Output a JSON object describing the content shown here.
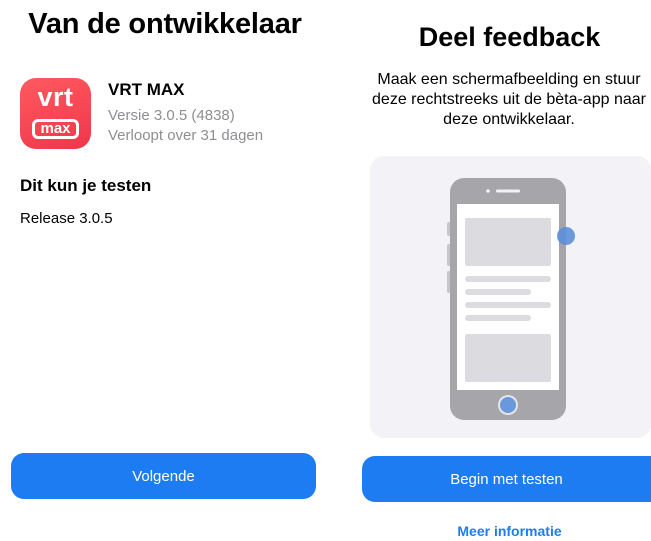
{
  "left": {
    "title": "Van de ontwikkelaar",
    "app": {
      "icon_top": "vrt",
      "icon_bottom": "max",
      "name": "VRT MAX",
      "version": "Versie 3.0.5 (4838)",
      "expiry": "Verloopt over 31 dagen"
    },
    "section_heading": "Dit kun je testen",
    "release_note": "Release 3.0.5",
    "next_button": "Volgende"
  },
  "right": {
    "title": "Deel feedback",
    "description": "Maak een schermafbeelding en stuur deze rechtstreeks uit de bèta-app naar deze ontwikkelaar.",
    "illustration_icon": "phone-screenshot-illustration",
    "start_button": "Begin met testen",
    "more_link": "Meer informatie"
  },
  "colors": {
    "accent": "#1e7cf2",
    "app_icon": "#f0364b",
    "secondary_text": "#8e8e93",
    "illustration_bg": "#f2f2f7",
    "touch_dot": "#5b8fd9"
  }
}
